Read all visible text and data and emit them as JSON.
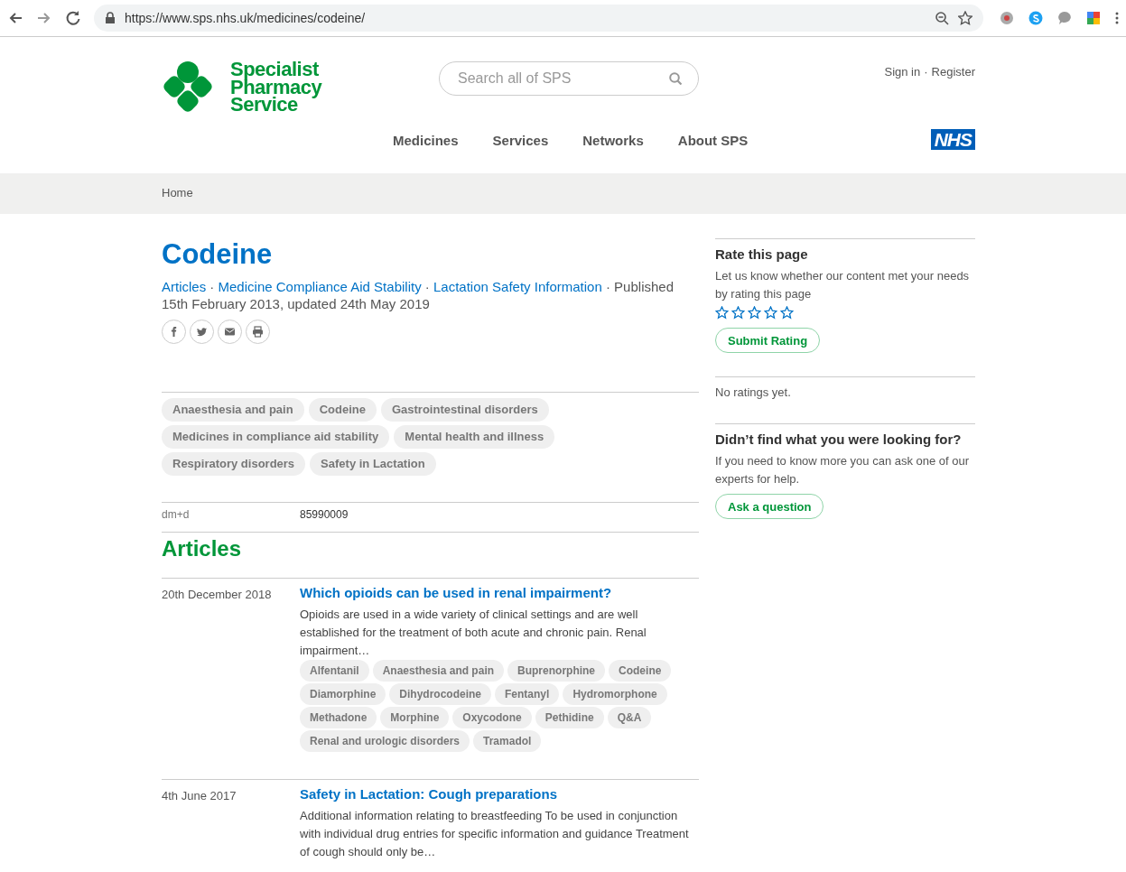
{
  "browser": {
    "url": "https://www.sps.nhs.uk/medicines/codeine/"
  },
  "header": {
    "logo_lines": [
      "Specialist",
      "Pharmacy",
      "Service"
    ],
    "search": {
      "placeholder": "Search all of SPS"
    },
    "account_links": [
      "Sign in",
      "Register"
    ],
    "account_separator": "·",
    "nav": [
      {
        "label": "Medicines"
      },
      {
        "label": "Services"
      },
      {
        "label": "Networks"
      },
      {
        "label": "About SPS"
      }
    ],
    "nhs_logo": "NHS"
  },
  "breadcrumb": [
    "Home"
  ],
  "page": {
    "title": "Codeine",
    "categories": [
      "Articles",
      "Medicine Compliance Aid Stability",
      "Lactation Safety Information"
    ],
    "meta_separator": "·",
    "published": "Published 15th February 2013, updated 24th May 2019",
    "share": [
      {
        "kind": "facebook"
      },
      {
        "kind": "twitter"
      },
      {
        "kind": "email"
      },
      {
        "kind": "print"
      }
    ],
    "tags": [
      "Anaesthesia and pain",
      "Codeine",
      "Gastrointestinal disorders",
      "Medicines in compliance aid stability",
      "Mental health and illness",
      "Respiratory disorders",
      "Safety in Lactation"
    ],
    "identifiers": [
      {
        "label": "dm+d",
        "value": "85990009"
      }
    ],
    "articles_heading": "Articles",
    "articles": [
      {
        "date": "20th December 2018",
        "title": "Which opioids can be used in renal impairment?",
        "summary": "Opioids are used in a wide variety of clinical settings and are well established for the treatment of both acute and chronic pain. Renal impairment…",
        "tags": [
          "Alfentanil",
          "Anaesthesia and pain",
          "Buprenorphine",
          "Codeine",
          "Diamorphine",
          "Dihydrocodeine",
          "Fentanyl",
          "Hydromorphone",
          "Methadone",
          "Morphine",
          "Oxycodone",
          "Pethidine",
          "Q&A",
          "Renal and urologic disorders",
          "Tramadol"
        ]
      },
      {
        "date": "4th June 2017",
        "title": "Safety in Lactation: Cough preparations",
        "summary": "Additional information relating to breastfeeding To be used in conjunction with individual drug entries for specific information and guidance Treatment of cough should only be…"
      }
    ]
  },
  "sidebar": {
    "rating": {
      "heading": "Rate this page",
      "text": "Let us know whether our content met your needs by rating this page",
      "stars": 0,
      "button": "Submit Rating",
      "status": "No ratings yet."
    },
    "help": {
      "heading": "Didn’t find what you were looking for?",
      "text": "If you need to know more you can ask one of our experts for help.",
      "button": "Ask a question"
    }
  }
}
